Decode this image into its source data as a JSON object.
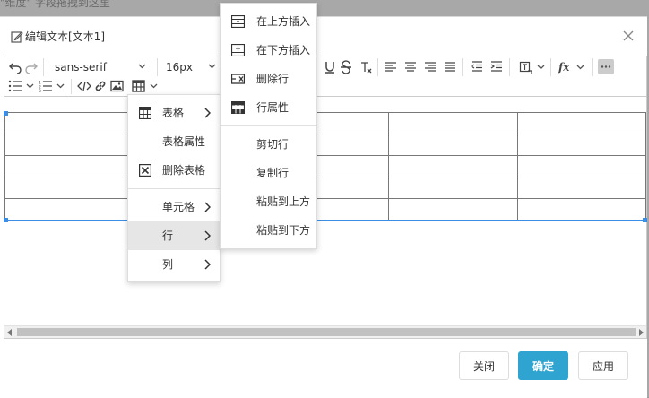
{
  "background_hint": "\"维度\" 字段拖拽到这里",
  "dialog": {
    "title": "编辑文本[文本1]",
    "close_label": "×"
  },
  "toolbar": {
    "font_family": "sans-serif",
    "font_size": "16px"
  },
  "context_menu": {
    "items": [
      {
        "label": "表格",
        "icon": "table-icon",
        "submenu": true
      },
      {
        "label": "表格属性",
        "icon": "",
        "submenu": false
      },
      {
        "label": "删除表格",
        "icon": "delete-table-icon",
        "submenu": false
      },
      {
        "label": "单元格",
        "icon": "",
        "submenu": true
      },
      {
        "label": "行",
        "icon": "",
        "submenu": true,
        "active": true
      },
      {
        "label": "列",
        "icon": "",
        "submenu": true
      }
    ]
  },
  "row_submenu": {
    "items": [
      {
        "label": "在上方插入",
        "icon": "insert-row-above-icon"
      },
      {
        "label": "在下方插入",
        "icon": "insert-row-below-icon"
      },
      {
        "label": "删除行",
        "icon": "delete-row-icon"
      },
      {
        "label": "行属性",
        "icon": "row-properties-icon"
      },
      {
        "label": "剪切行",
        "icon": ""
      },
      {
        "label": "复制行",
        "icon": ""
      },
      {
        "label": "粘贴到上方",
        "icon": ""
      },
      {
        "label": "粘贴到下方",
        "icon": ""
      }
    ]
  },
  "footer": {
    "close_label": "关闭",
    "ok_label": "确定",
    "apply_label": "应用"
  },
  "colors": {
    "primary": "#2fa4d0",
    "selection": "#3a8ee6"
  }
}
